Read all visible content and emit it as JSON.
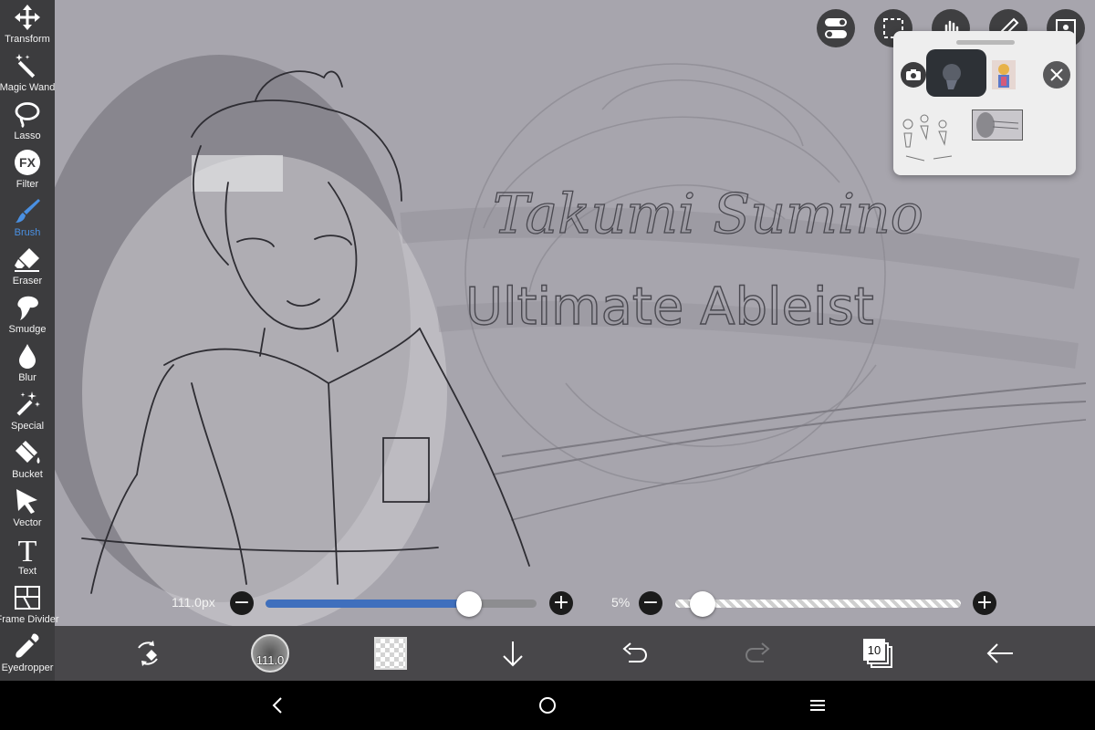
{
  "tools": [
    {
      "label": "Transform",
      "icon": "move-arrows-icon"
    },
    {
      "label": "Magic Wand",
      "icon": "magic-wand-icon"
    },
    {
      "label": "Lasso",
      "icon": "lasso-icon"
    },
    {
      "label": "Filter",
      "icon": "fx-icon"
    },
    {
      "label": "Brush",
      "icon": "brush-icon"
    },
    {
      "label": "Eraser",
      "icon": "eraser-icon"
    },
    {
      "label": "Smudge",
      "icon": "smudge-icon"
    },
    {
      "label": "Blur",
      "icon": "droplet-icon"
    },
    {
      "label": "Special",
      "icon": "sparkle-icon"
    },
    {
      "label": "Bucket",
      "icon": "bucket-icon"
    },
    {
      "label": "Vector",
      "icon": "cursor-arrow-icon"
    },
    {
      "label": "Text",
      "icon": "text-t-icon"
    },
    {
      "label": "Frame Divider",
      "icon": "frame-divider-icon"
    },
    {
      "label": "Eyedropper",
      "icon": "eyedropper-icon"
    }
  ],
  "active_tool": "Brush",
  "filter_icon_text": "FX",
  "text_icon_text": "T",
  "brush_size": {
    "label": "111.0px",
    "value": 111.0,
    "fraction": 0.75
  },
  "opacity": {
    "label": "5%",
    "fraction": 0.05
  },
  "bottom_bar": {
    "brush_preview_text": "111.0",
    "layer_count": "10"
  },
  "canvas_text": {
    "name": "Takumi Sumino",
    "title": "Ultimate Ableist"
  },
  "colors": {
    "accent": "#4a90e2",
    "toolbar_bg": "#3c3c3e",
    "bottom_bg": "#48474a",
    "canvas_bg": "#a7a5ad",
    "track_fill": "#3f6fbd"
  }
}
